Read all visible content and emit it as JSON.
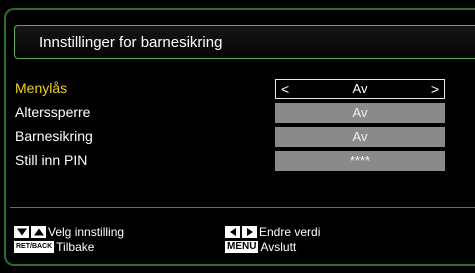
{
  "header": {
    "title": "Innstillinger for barnesikring"
  },
  "settings": {
    "rows": [
      {
        "label": "Menylås",
        "value": "Av",
        "selected": true
      },
      {
        "label": "Alterssperre",
        "value": "Av",
        "selected": false
      },
      {
        "label": "Barnesikring",
        "value": "Av",
        "selected": false
      },
      {
        "label": "Still inn PIN",
        "value": "****",
        "selected": false
      }
    ],
    "arrow_left": "<",
    "arrow_right": ">"
  },
  "footer": {
    "select_hint": "Velg innstilling",
    "change_hint": "Endre verdi",
    "back_key": "RET/BACK",
    "back_hint": "Tilbake",
    "menu_key": "MENU",
    "exit_hint": "Avslutt"
  },
  "colors": {
    "active_label": "#f2d11e",
    "border_green": "#2e6b2e",
    "value_box": "#8a8a8a"
  }
}
